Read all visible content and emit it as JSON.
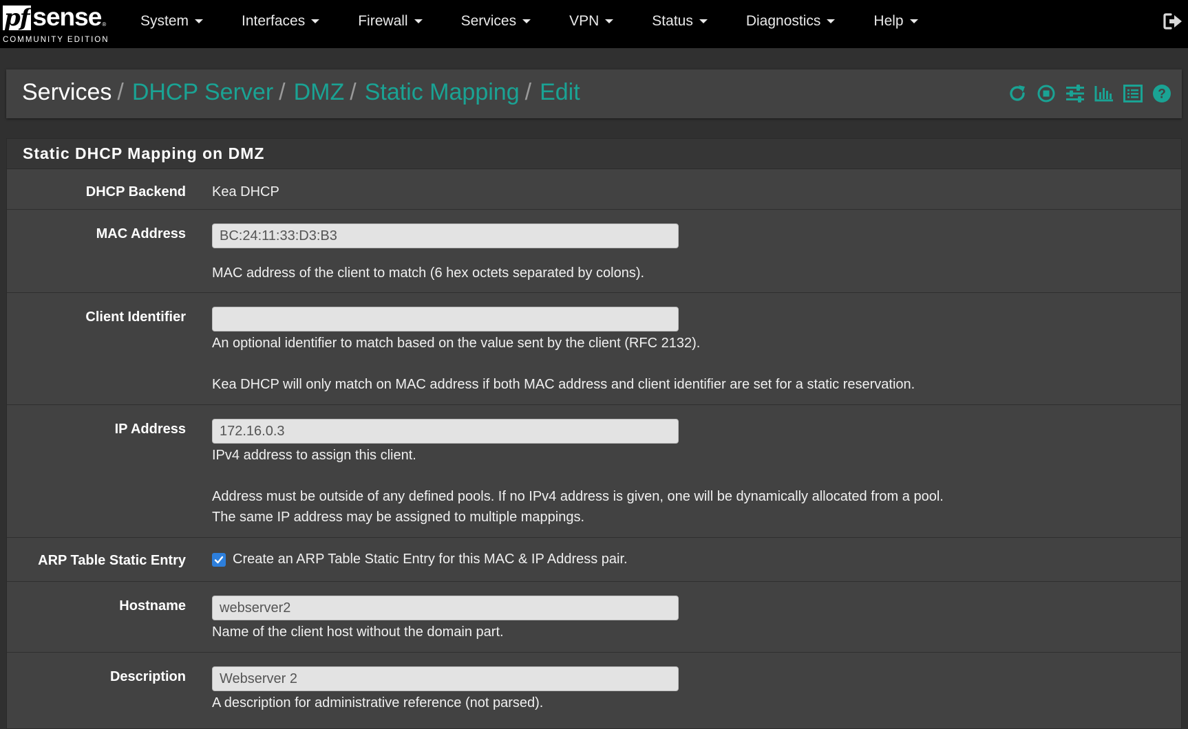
{
  "brand": {
    "logo_pf": "pf",
    "logo_sense": "sense",
    "logo_reg": "®",
    "edition": "COMMUNITY EDITION"
  },
  "nav": [
    {
      "label": "System"
    },
    {
      "label": "Interfaces"
    },
    {
      "label": "Firewall"
    },
    {
      "label": "Services"
    },
    {
      "label": "VPN"
    },
    {
      "label": "Status"
    },
    {
      "label": "Diagnostics"
    },
    {
      "label": "Help"
    }
  ],
  "breadcrumb": {
    "root": "Services",
    "items": [
      {
        "label": "DHCP Server"
      },
      {
        "label": "DMZ"
      },
      {
        "label": "Static Mapping"
      },
      {
        "label": "Edit"
      }
    ],
    "separator": "/"
  },
  "header_icons": [
    "restart-service-icon",
    "stop-service-icon",
    "settings-sliders-icon",
    "status-chart-icon",
    "log-list-icon",
    "help-icon"
  ],
  "accent_color": "#1aa394",
  "panel": {
    "title": "Static DHCP Mapping on DMZ",
    "backend": {
      "label": "DHCP Backend",
      "value": "Kea DHCP"
    },
    "mac": {
      "label": "MAC Address",
      "value": "BC:24:11:33:D3:B3",
      "help": "MAC address of the client to match (6 hex octets separated by colons)."
    },
    "client_id": {
      "label": "Client Identifier",
      "value": "",
      "help1": "An optional identifier to match based on the value sent by the client (RFC 2132).",
      "help2": "Kea DHCP will only match on MAC address if both MAC address and client identifier are set for a static reservation."
    },
    "ip": {
      "label": "IP Address",
      "value": "172.16.0.3",
      "help1": "IPv4 address to assign this client.",
      "help2": "Address must be outside of any defined pools. If no IPv4 address is given, one will be dynamically allocated from a pool.",
      "help3": "The same IP address may be assigned to multiple mappings."
    },
    "arp": {
      "label": "ARP Table Static Entry",
      "checked": true,
      "text": "Create an ARP Table Static Entry for this MAC & IP Address pair."
    },
    "hostname": {
      "label": "Hostname",
      "value": "webserver2",
      "help": "Name of the client host without the domain part."
    },
    "description": {
      "label": "Description",
      "value": "Webserver 2",
      "help": "A description for administrative reference (not parsed)."
    }
  }
}
